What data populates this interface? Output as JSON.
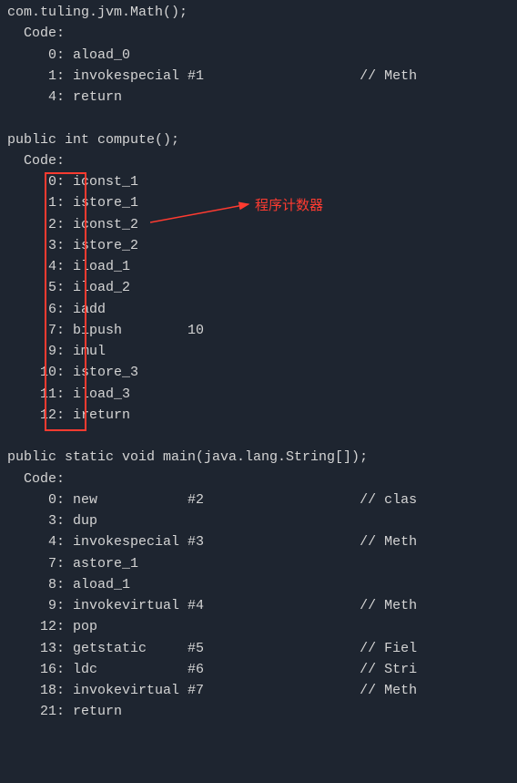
{
  "constructor": {
    "signature": "com.tuling.jvm.Math();",
    "code_label": "  Code:",
    "lines": [
      {
        "offset": "     0: ",
        "instr": "aload_0",
        "comment": ""
      },
      {
        "offset": "     1: ",
        "instr": "invokespecial #1",
        "comment": "                   // Meth"
      },
      {
        "offset": "     4: ",
        "instr": "return",
        "comment": ""
      }
    ]
  },
  "compute": {
    "signature": "public int compute();",
    "code_label": "  Code:",
    "lines": [
      {
        "offset": "     0: ",
        "instr": "iconst_1",
        "comment": ""
      },
      {
        "offset": "     1: ",
        "instr": "istore_1",
        "comment": ""
      },
      {
        "offset": "     2: ",
        "instr": "iconst_2",
        "comment": ""
      },
      {
        "offset": "     3: ",
        "instr": "istore_2",
        "comment": ""
      },
      {
        "offset": "     4: ",
        "instr": "iload_1",
        "comment": ""
      },
      {
        "offset": "     5: ",
        "instr": "iload_2",
        "comment": ""
      },
      {
        "offset": "     6: ",
        "instr": "iadd",
        "comment": ""
      },
      {
        "offset": "     7: ",
        "instr": "bipush        10",
        "comment": ""
      },
      {
        "offset": "     9: ",
        "instr": "imul",
        "comment": ""
      },
      {
        "offset": "    10: ",
        "instr": "istore_3",
        "comment": ""
      },
      {
        "offset": "    11: ",
        "instr": "iload_3",
        "comment": ""
      },
      {
        "offset": "    12: ",
        "instr": "ireturn",
        "comment": ""
      }
    ]
  },
  "main": {
    "signature": "public static void main(java.lang.String[]);",
    "code_label": "  Code:",
    "lines": [
      {
        "offset": "     0: ",
        "instr": "new           #2",
        "comment": "                   // clas"
      },
      {
        "offset": "     3: ",
        "instr": "dup",
        "comment": ""
      },
      {
        "offset": "     4: ",
        "instr": "invokespecial #3",
        "comment": "                   // Meth"
      },
      {
        "offset": "     7: ",
        "instr": "astore_1",
        "comment": ""
      },
      {
        "offset": "     8: ",
        "instr": "aload_1",
        "comment": ""
      },
      {
        "offset": "     9: ",
        "instr": "invokevirtual #4",
        "comment": "                   // Meth"
      },
      {
        "offset": "    12: ",
        "instr": "pop",
        "comment": ""
      },
      {
        "offset": "    13: ",
        "instr": "getstatic     #5",
        "comment": "                   // Fiel"
      },
      {
        "offset": "    16: ",
        "instr": "ldc           #6",
        "comment": "                   // Stri"
      },
      {
        "offset": "    18: ",
        "instr": "invokevirtual #7",
        "comment": "                   // Meth"
      },
      {
        "offset": "    21: ",
        "instr": "return",
        "comment": ""
      }
    ]
  },
  "annotation": {
    "text": "程序计数器"
  }
}
